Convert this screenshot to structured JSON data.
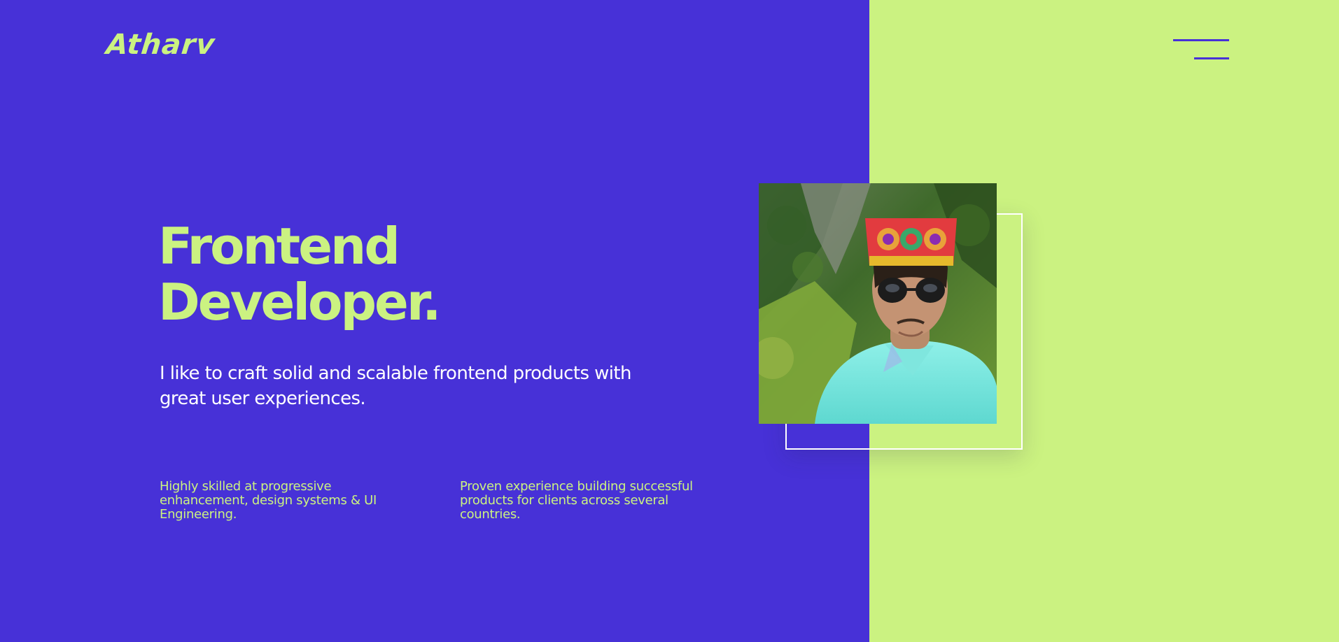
{
  "brand": {
    "logo_text": "Atharv"
  },
  "nav": {
    "menu_icon": "hamburger-menu-icon"
  },
  "hero": {
    "title_line1": "Frontend",
    "title_line2": "Developer.",
    "subtitle": "I like to craft solid and scalable frontend products with great user experiences."
  },
  "features": [
    {
      "text": "Highly skilled at progressive enhancement, design systems & UI Engineering."
    },
    {
      "text": "Proven experience building successful products for clients across several countries."
    }
  ],
  "photo": {
    "alt": "Portrait photo"
  },
  "colors": {
    "background": "#4731d7",
    "accent": "#cbf281",
    "text_light": "#ffffff"
  }
}
